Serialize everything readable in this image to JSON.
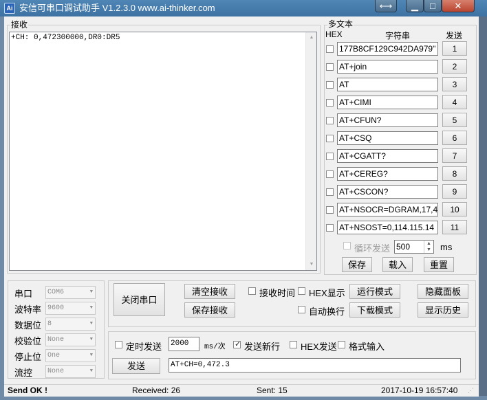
{
  "window": {
    "title": "安信可串口调试助手 V1.2.3.0     www.ai-thinker.com",
    "icon_text": "Ai"
  },
  "receive": {
    "group_label": "接收",
    "content": "+CH: 0,472300000,DR0:DR5"
  },
  "multi_text": {
    "title": "多文本",
    "col_hex": "HEX",
    "col_string": "字符串",
    "col_send": "发送",
    "rows": [
      {
        "text": "177B8CF129C942DA979\"",
        "num": "1"
      },
      {
        "text": "AT+join",
        "num": "2"
      },
      {
        "text": "AT",
        "num": "3"
      },
      {
        "text": "AT+CIMI",
        "num": "4"
      },
      {
        "text": "AT+CFUN?",
        "num": "5"
      },
      {
        "text": "AT+CSQ",
        "num": "6"
      },
      {
        "text": "AT+CGATT?",
        "num": "7"
      },
      {
        "text": "AT+CEREG?",
        "num": "8"
      },
      {
        "text": "AT+CSCON?",
        "num": "9"
      },
      {
        "text": "AT+NSOCR=DGRAM,17,4",
        "num": "10"
      },
      {
        "text": "AT+NSOST=0,114.115.14",
        "num": "11"
      }
    ],
    "loop_label": "循环发送",
    "loop_value": "500",
    "loop_unit": "ms",
    "save_label": "保存",
    "load_label": "载入",
    "reset_label": "重置"
  },
  "serial": {
    "port_label": "串口",
    "port_value": "COM6",
    "baud_label": "波特率",
    "baud_value": "9600",
    "data_label": "数据位",
    "data_value": "8",
    "parity_label": "校验位",
    "parity_value": "None",
    "stop_label": "停止位",
    "stop_value": "One",
    "flow_label": "流控",
    "flow_value": "None"
  },
  "controls": {
    "close_port": "关闭串口",
    "clear_recv": "清空接收",
    "save_recv": "保存接收",
    "recv_time": "接收时间",
    "hex_display": "HEX显示",
    "auto_newline": "自动换行",
    "run_mode": "运行模式",
    "download_mode": "下载模式",
    "hide_panel": "隐藏面板",
    "show_history": "显示历史"
  },
  "send": {
    "timed_send": "定时发送",
    "interval": "2000",
    "interval_unit": "ms/次",
    "send_newline": "发送新行",
    "hex_send": "HEX发送",
    "format_input": "格式输入",
    "send_button": "发送",
    "input_value": "AT+CH=0,472.3"
  },
  "status": {
    "message": "Send OK !",
    "received": "Received: 26",
    "sent": "Sent: 15",
    "datetime": "2017-10-19 16:57:40"
  },
  "colors": {
    "titlebar": "#3d72a3",
    "close_button": "#c75a45",
    "window_bg": "#f0f0f0"
  }
}
